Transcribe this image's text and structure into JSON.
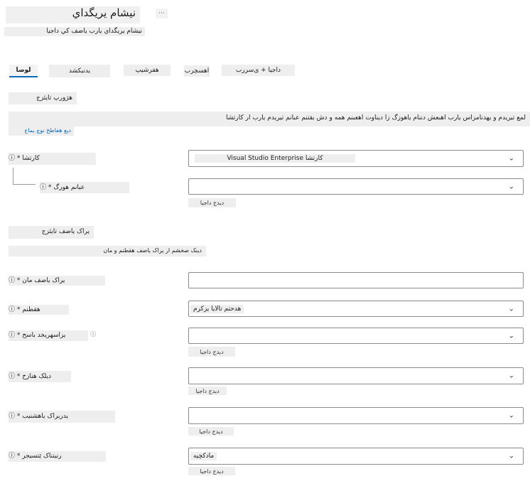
{
  "header": {
    "title": "نیشام یریگداي",
    "subtitle": "نیشام یریگداي یارب یاضف کي داجيا",
    "more": "···"
  },
  "tabs": [
    {
      "label": "لوصا",
      "active": true
    },
    {
      "label": "یدنبکشد",
      "active": false
    },
    {
      "label": "هفرشیپ",
      "active": false
    },
    {
      "label": "اهسچرب",
      "active": false
    },
    {
      "label": "داجیا + ی‌سررب",
      "active": false
    }
  ],
  "project": {
    "heading": "هژورپ تایئزج",
    "description": "لمع تیریدم و یهدنامزاس یارب اهبعش دننام یاهوزگ زا دیناوت اهعبنم همه و دش بقتنم عبانم تیریدم یارب ار کارتشا",
    "info_link": "دیع هفاطخ نوچ یماع",
    "subscription_label": "کارتشا * ⓘ",
    "subscription_value": "Visual Studio Enterprise کارتشا",
    "resource_group_label": "عبانم هورگ * ⓘ",
    "resource_group_value": "",
    "create_new": "دیدج داجیا"
  },
  "workspace": {
    "heading": "یراک یاضف تایئزج",
    "description": "دینک صخشم ار یراک یاضف هقطنم و مان",
    "name_label": "یراک یاضف مان * ⓘ",
    "name_value": "",
    "region_label": "هقطنم * ⓘ",
    "region_value": "هدحتم تالایا یزکرم",
    "storage_label": "یزاسهریخد باسح * ⓘ",
    "storage_value": "",
    "keyvault_label": "دیلک هنازخ * ⓘ",
    "keyvault_value": "",
    "insights_label": "یدربراک یاهشنیب * ⓘ",
    "insights_value": "",
    "registry_label": "رنیتناک ێتسیجر * ⓘ",
    "registry_value": "مادکچیه",
    "create_new": "دیدج داجیا"
  },
  "icons": {
    "chevron": "chevron-down-icon",
    "info": "info-icon"
  }
}
